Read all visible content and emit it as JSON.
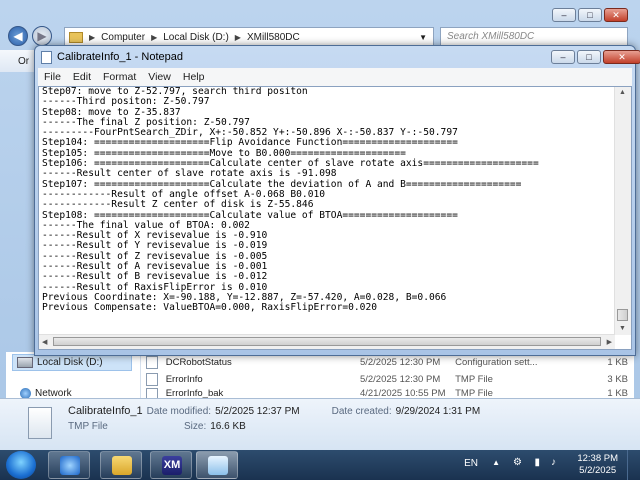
{
  "explorer": {
    "path": [
      "Computer",
      "Local Disk (D:)",
      "XMill580DC"
    ],
    "search_placeholder": "Search XMill580DC",
    "toolbar_stub": "Or",
    "nav": {
      "selected": "Local Disk (D:)",
      "network": "Network"
    },
    "files": [
      {
        "name": "DCRobotStatus",
        "date": "5/2/2025 12:30 PM",
        "type": "Configuration sett...",
        "size": "1 KB"
      },
      {
        "name": "ErrorInfo",
        "date": "5/2/2025 12:30 PM",
        "type": "TMP File",
        "size": "3 KB"
      },
      {
        "name": "ErrorInfo_bak",
        "date": "4/21/2025 10:55 PM",
        "type": "TMP File",
        "size": "1 KB"
      }
    ],
    "details": {
      "filename": "CalibrateInfo_1",
      "modified_label": "Date modified:",
      "modified": "5/2/2025 12:37 PM",
      "created_label": "Date created:",
      "created": "9/29/2024 1:31 PM",
      "type": "TMP File",
      "size_label": "Size:",
      "size": "16.6 KB"
    }
  },
  "notepad": {
    "title": "CalibrateInfo_1 - Notepad",
    "menu": [
      "File",
      "Edit",
      "Format",
      "View",
      "Help"
    ],
    "lines": [
      "Step07: move to Z-52.797, search third positon",
      "------Third positon: Z-50.797",
      "Step08: move to Z-35.837",
      "------The final Z position: Z-50.797",
      "---------FourPntSearch_ZDir, X+:-50.852 Y+:-50.896 X-:-50.837 Y-:-50.797",
      "Step104: ====================Flip Avoidance Function====================",
      "Step105: ====================Move to B0.000====================",
      "Step106: ====================Calculate center of slave rotate axis====================",
      "------Result center of slave rotate axis is -91.098",
      "Step107: ====================Calculate the deviation of A and B====================",
      "------------Result of angle offset A-0.068 B0.010",
      "------------Result Z center of disk is Z-55.846",
      "Step108: ====================Calculate value of BTOA====================",
      "------The final value of BTOA: 0.002",
      "------Result of X revisevalue is -0.910",
      "------Result of Y revisevalue is -0.019",
      "------Result of Z revisevalue is -0.005",
      "------Result of A revisevalue is -0.001",
      "------Result of B revisevalue is -0.012",
      "------Result of RaxisFlipError is 0.010",
      "Previous Coordinate: X=-90.188, Y=-12.887, Z=-57.420, A=0.028, B=0.066",
      "Previous Compensate: ValueBTOA=0.000, RaxisFlipError=0.020"
    ]
  },
  "taskbar": {
    "lang": "EN",
    "time": "12:38 PM",
    "date": "5/2/2025"
  },
  "colors": {
    "taskbar": "#1a3250",
    "title_glass": "#c6daf2"
  }
}
